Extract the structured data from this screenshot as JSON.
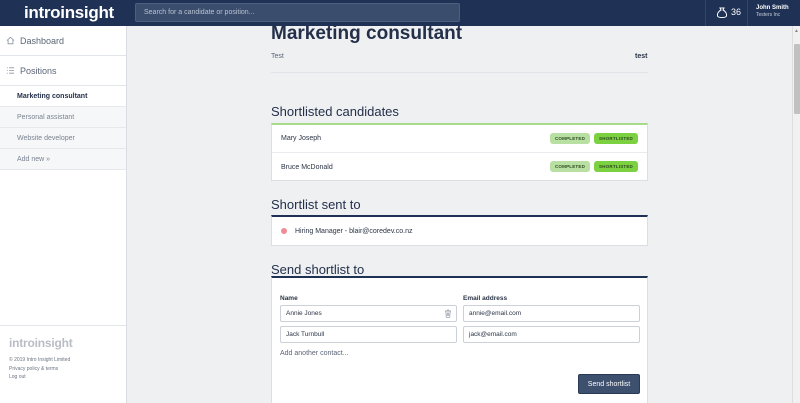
{
  "topbar": {
    "logo": "introinsight",
    "search_placeholder": "Search for a candidate or position...",
    "count": "36",
    "user_name": "John Smith",
    "user_company": "Testers Inc"
  },
  "sidebar": {
    "dashboard": "Dashboard",
    "positions": "Positions",
    "items": [
      "Marketing consultant",
      "Personal assistant",
      "Website developer",
      "Add new »"
    ],
    "footer_logo": "introinsight",
    "copyright": "© 2019 Intro Insight Limited",
    "privacy": "Privacy policy & terms",
    "logout": "Log out"
  },
  "page": {
    "title": "Marketing consultant",
    "meta_left": "Test",
    "meta_right": "test"
  },
  "shortlisted": {
    "title": "Shortlisted candidates",
    "candidates": [
      {
        "name": "Mary Joseph",
        "status1": "COMPLETED",
        "status2": "SHORTLISTED"
      },
      {
        "name": "Bruce McDonald",
        "status1": "COMPLETED",
        "status2": "SHORTLISTED"
      }
    ]
  },
  "sent_to": {
    "title": "Shortlist sent to",
    "entry": "Hiring Manager - blair@coredev.co.nz"
  },
  "send": {
    "title": "Send shortlist to",
    "name_label": "Name",
    "email_label": "Email address",
    "contacts": [
      {
        "name": "Annie Jones",
        "email": "annie@email.com"
      },
      {
        "name": "Jack Turnbull",
        "email": "jack@email.com"
      }
    ],
    "add_another": "Add another contact...",
    "button": "Send shortlist"
  },
  "colors": {
    "navy": "#1f3154",
    "completed": "#b9e0a3",
    "shortlisted": "#7bd13f",
    "status_dot": "#ef8c95"
  }
}
